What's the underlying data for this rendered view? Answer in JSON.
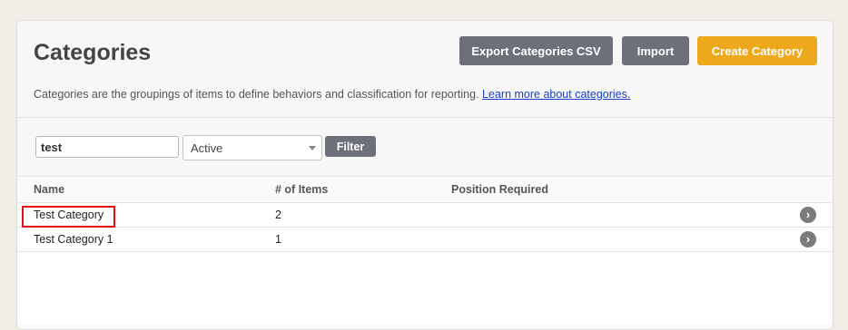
{
  "page": {
    "title": "Categories",
    "description": "Categories are the groupings of items to define behaviors and classification for reporting.",
    "learn_more_link": "Learn more about categories."
  },
  "actions": {
    "export_label": "Export Categories CSV",
    "import_label": "Import",
    "create_label": "Create Category"
  },
  "filters": {
    "search_value": "test",
    "status_selected": "Active",
    "filter_label": "Filter"
  },
  "table": {
    "columns": [
      "Name",
      "# of Items",
      "Position Required"
    ],
    "rows": [
      {
        "name": "Test Category",
        "items": "2",
        "position_required": ""
      },
      {
        "name": "Test Category 1",
        "items": "1",
        "position_required": ""
      }
    ]
  },
  "icons": {
    "row_action": "chevron-right-circle-icon"
  },
  "colors": {
    "primary_button": "#6d7079",
    "accent_button": "#eda81c",
    "link": "#1a3fcc",
    "highlight": "#e10e0e"
  }
}
